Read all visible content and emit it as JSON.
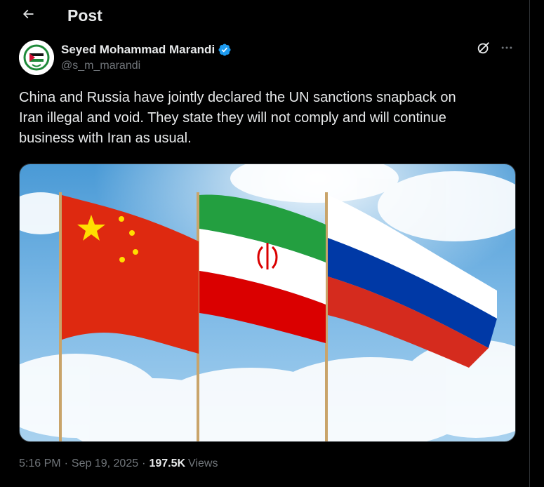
{
  "header": {
    "title": "Post",
    "back_icon": "arrow-left-icon"
  },
  "author": {
    "display_name": "Seyed Mohammad Marandi",
    "handle": "@s_m_marandi",
    "verified": true,
    "verified_color": "#1d9bf0",
    "avatar_icon": "palestine-flag-emblem-icon"
  },
  "actions": {
    "grok_icon": "grok-icon",
    "more_icon": "more-options-icon"
  },
  "post": {
    "text": "China and Russia have jointly declared the UN sanctions snapback on\nIran illegal and void. They state they will not comply and will continue\nbusiness with Iran as usual.",
    "media_description_icon": "flags-image"
  },
  "meta": {
    "time": "5:16 PM",
    "separator": "·",
    "date": "Sep 19, 2025",
    "views_count": "197.5K",
    "views_label": "Views"
  },
  "colors": {
    "background": "#000000",
    "text_primary": "#e7e9ea",
    "text_secondary": "#71767b",
    "border": "#2f3336"
  }
}
